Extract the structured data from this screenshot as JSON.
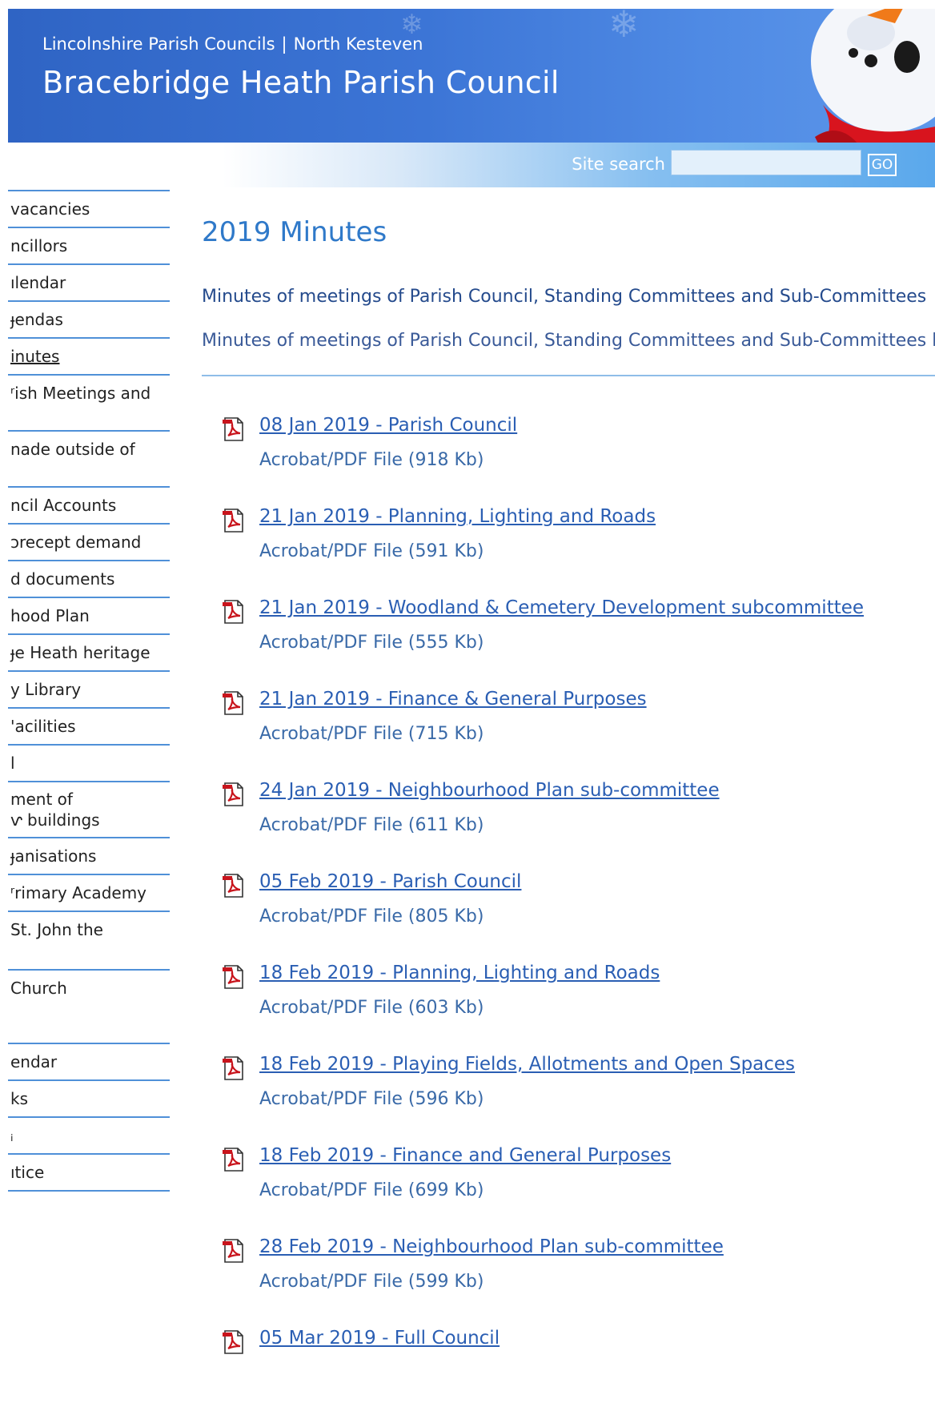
{
  "header": {
    "crumb_parent": "Lincolnshire Parish Councils",
    "crumb_separator": "|",
    "crumb_child": "North Kesteven",
    "site_title": "Bracebridge Heath Parish Council"
  },
  "search": {
    "label": "Site search",
    "value": "",
    "go_label": "GO"
  },
  "sidebar": {
    "items": [
      {
        "label": "vacancies"
      },
      {
        "label": "ncillors"
      },
      {
        "label": "ılendar"
      },
      {
        "label": "ɟendas"
      },
      {
        "label": "inutes"
      },
      {
        "label": "ʳish Meetings and"
      },
      {
        "label": "nade outside of"
      },
      {
        "label": "ncil Accounts"
      },
      {
        "label": "ɔrecept demand"
      },
      {
        "label": "d documents"
      },
      {
        "label": "hood Plan"
      },
      {
        "label": "ɟe Heath heritage"
      },
      {
        "label": "y Library"
      },
      {
        "label": "'acilities"
      },
      {
        "label": "l"
      },
      {
        "label": "ment of",
        "label2": "ⱱ buildings"
      },
      {
        "label": "ɟanisations"
      },
      {
        "label": "ʳrimary Academy"
      },
      {
        "label": "St. John the"
      },
      {
        "label": "Church"
      },
      {
        "label": "endar"
      },
      {
        "label": "ks"
      },
      {
        "label": "ᵢ"
      },
      {
        "label": "ıtice"
      }
    ]
  },
  "main": {
    "title": "2019 Minutes",
    "intro_1": "Minutes of meetings of Parish Council, Standing Committees and Sub-Committees",
    "intro_2": "Minutes of meetings of Parish Council, Standing Committees and Sub-Committees h",
    "documents": [
      {
        "title": "08 Jan 2019 - Parish Council",
        "meta": "Acrobat/PDF File (918 Kb)"
      },
      {
        "title": "21 Jan 2019 - Planning, Lighting and Roads",
        "meta": "Acrobat/PDF File (591 Kb)"
      },
      {
        "title": "21 Jan 2019 - Woodland & Cemetery Development subcommittee",
        "meta": "Acrobat/PDF File (555 Kb)"
      },
      {
        "title": "21 Jan 2019 - Finance & General Purposes",
        "meta": "Acrobat/PDF File (715 Kb)"
      },
      {
        "title": "24 Jan 2019 - Neighbourhood Plan sub-committee",
        "meta": "Acrobat/PDF File (611 Kb)"
      },
      {
        "title": "05 Feb 2019 - Parish Council",
        "meta": "Acrobat/PDF File (805 Kb)"
      },
      {
        "title": "18 Feb 2019 - Planning, Lighting and Roads",
        "meta": "Acrobat/PDF File (603 Kb)"
      },
      {
        "title": "18 Feb 2019 - Playing Fields, Allotments and Open Spaces",
        "meta": "Acrobat/PDF File (596 Kb)"
      },
      {
        "title": "18 Feb 2019 - Finance and General Purposes",
        "meta": "Acrobat/PDF File (699 Kb)"
      },
      {
        "title": "28 Feb 2019 - Neighbourhood Plan sub-committee",
        "meta": "Acrobat/PDF File (599 Kb)"
      },
      {
        "title": "05 Mar 2019 - Full Council",
        "meta": ""
      }
    ]
  },
  "icons": {
    "pdf": "pdf-file-icon",
    "decor": "snowflake-icon"
  },
  "colors": {
    "header_blue": "#3c75d6",
    "link_blue": "#2a5eb3",
    "title_blue": "#2f79c9",
    "nav_rule": "#4f90d8"
  }
}
